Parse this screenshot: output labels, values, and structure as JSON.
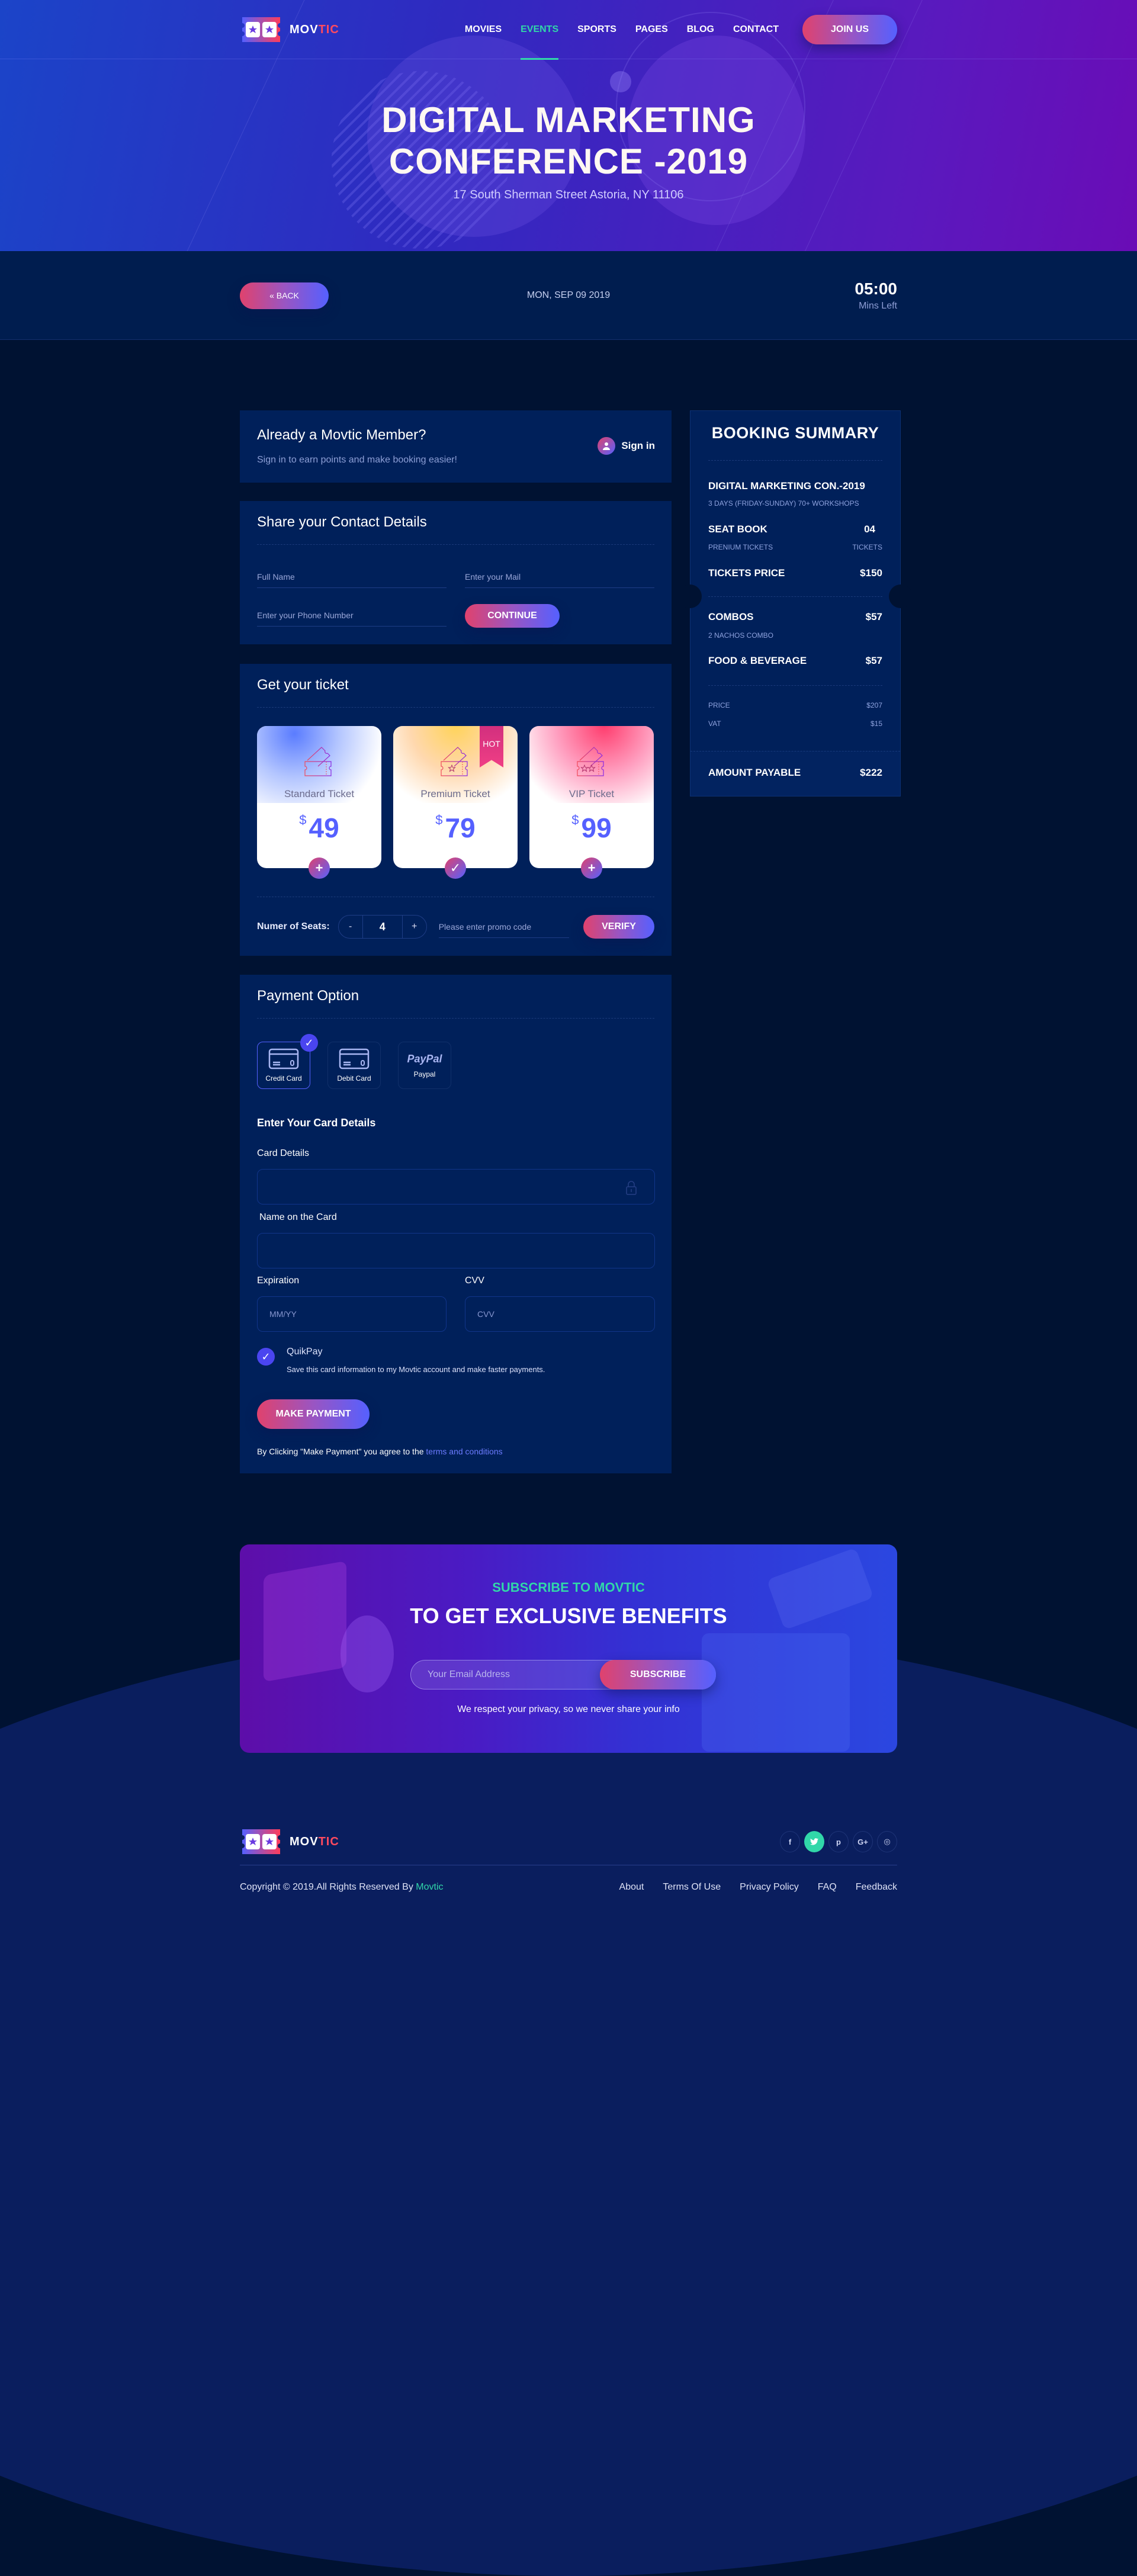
{
  "brand": {
    "name_part1": "MOV",
    "name_part2": "TIC"
  },
  "nav": {
    "items": [
      {
        "label": "MOVIES",
        "active": false
      },
      {
        "label": "EVENTS",
        "active": true
      },
      {
        "label": "SPORTS",
        "active": false
      },
      {
        "label": "PAGES",
        "active": false
      },
      {
        "label": "BLOG",
        "active": false
      },
      {
        "label": "CONTACT",
        "active": false
      }
    ],
    "join_label": "JOIN US"
  },
  "hero": {
    "title_line1": "DIGITAL MARKETING",
    "title_line2": "CONFERENCE -2019",
    "address": "17 South Sherman Street Astoria, NY 11106"
  },
  "timerbar": {
    "back_label": "« BACK",
    "date": "MON, SEP 09 2019",
    "time_left": "05:00",
    "time_unit": "Mins Left"
  },
  "member": {
    "title": "Already a Movtic Member?",
    "subtitle": "Sign in to earn points and make booking easier!",
    "signin_label": "Sign in"
  },
  "contact": {
    "title": "Share your Contact  Details",
    "fullname_placeholder": "Full Name",
    "email_placeholder": "Enter your Mail",
    "phone_placeholder": "Enter your Phone Number",
    "continue_label": "CONTINUE"
  },
  "tickets": {
    "title": "Get your ticket",
    "items": [
      {
        "name": "Standard Ticket",
        "currency": "$",
        "price": "49",
        "action": "+",
        "selected": false,
        "badge": ""
      },
      {
        "name": "Premium Ticket",
        "currency": "$",
        "price": "79",
        "action": "✓",
        "selected": true,
        "badge": "HOT"
      },
      {
        "name": "VIP Ticket",
        "currency": "$",
        "price": "99",
        "action": "+",
        "selected": false,
        "badge": ""
      }
    ],
    "seats_label": "Numer of Seats:",
    "seats_minus": "-",
    "seats_value": "4",
    "seats_plus": "+",
    "promo_placeholder": "Please enter promo code",
    "verify_label": "VERIFY"
  },
  "payment": {
    "title": "Payment Option",
    "methods": [
      {
        "label": "Credit Card",
        "icon": "credit-card-icon",
        "selected": true
      },
      {
        "label": "Debit Card",
        "icon": "debit-card-icon",
        "selected": false
      },
      {
        "label": "Paypal",
        "icon": "paypal-logo",
        "logo_text": "PayPal",
        "selected": false
      }
    ],
    "card_section_title": "Enter Your Card Details",
    "card_details_label": "Card Details",
    "card_details_value": "",
    "name_label": "Name on the Card",
    "name_value": "",
    "expiration_label": "Expiration",
    "expiration_placeholder": "MM/YY",
    "cvv_label": "CVV",
    "cvv_placeholder": "CVV",
    "quikpay_title": "QuikPay",
    "quikpay_desc": "Save this card information to my Movtic account and make faster payments.",
    "quikpay_checked": true,
    "make_payment_label": "MAKE PAYMENT",
    "terms_prefix": "By Clicking \"Make Payment\" you agree to the ",
    "terms_link": "terms and conditions"
  },
  "summary": {
    "title": "BOOKING SUMMARY",
    "event_name": "DIGITAL MARKETING CON.-2019",
    "event_desc": "3 DAYS (FRIDAY-SUNDAY) 70+ WORKSHOPS",
    "seat_label": "SEAT BOOK",
    "seat_value": "04",
    "seat_type": "PRENIUM TICKETS",
    "seat_unit": "TICKETS",
    "tickets_price_label": "TICKETS  PRICE",
    "tickets_price_value": "$150",
    "combos_label": "COMBOS",
    "combos_value": "$57",
    "combos_desc": "2 NACHOS COMBO",
    "food_label": "FOOD & BEVERAGE",
    "food_value": "$57",
    "price_label": "PRICE",
    "price_value": "$207",
    "vat_label": "VAT",
    "vat_value": "$15",
    "payable_label": "AMOUNT PAYABLE",
    "payable_value": "$222"
  },
  "subscribe": {
    "kicker": "SUBSCRIBE TO MOVTIC",
    "title": "TO GET EXCLUSIVE BENEFITS",
    "email_placeholder": "Your Email Address",
    "button_label": "SUBSCRIBE",
    "note": "We respect your privacy, so we never share your info"
  },
  "footer": {
    "socials": [
      {
        "name": "facebook",
        "glyph": "f",
        "active": false
      },
      {
        "name": "twitter",
        "glyph": "t",
        "active": true
      },
      {
        "name": "pinterest",
        "glyph": "p",
        "active": false
      },
      {
        "name": "google-plus",
        "glyph": "G+",
        "active": false
      },
      {
        "name": "instagram",
        "glyph": "◎",
        "active": false
      }
    ],
    "copyright_prefix": "Copyright © 2019.All Rights Reserved By ",
    "copyright_brand": "Movtic",
    "links": [
      "About",
      "Terms Of Use",
      "Privacy Policy",
      "FAQ",
      "Feedback"
    ]
  },
  "colors": {
    "accent_green": "#31d7a9",
    "brand_red": "#ff4a5f",
    "gradient_start": "#e0426d",
    "gradient_end": "#5560ff",
    "page_bg": "#001232",
    "panel_bg": "#00205a"
  }
}
